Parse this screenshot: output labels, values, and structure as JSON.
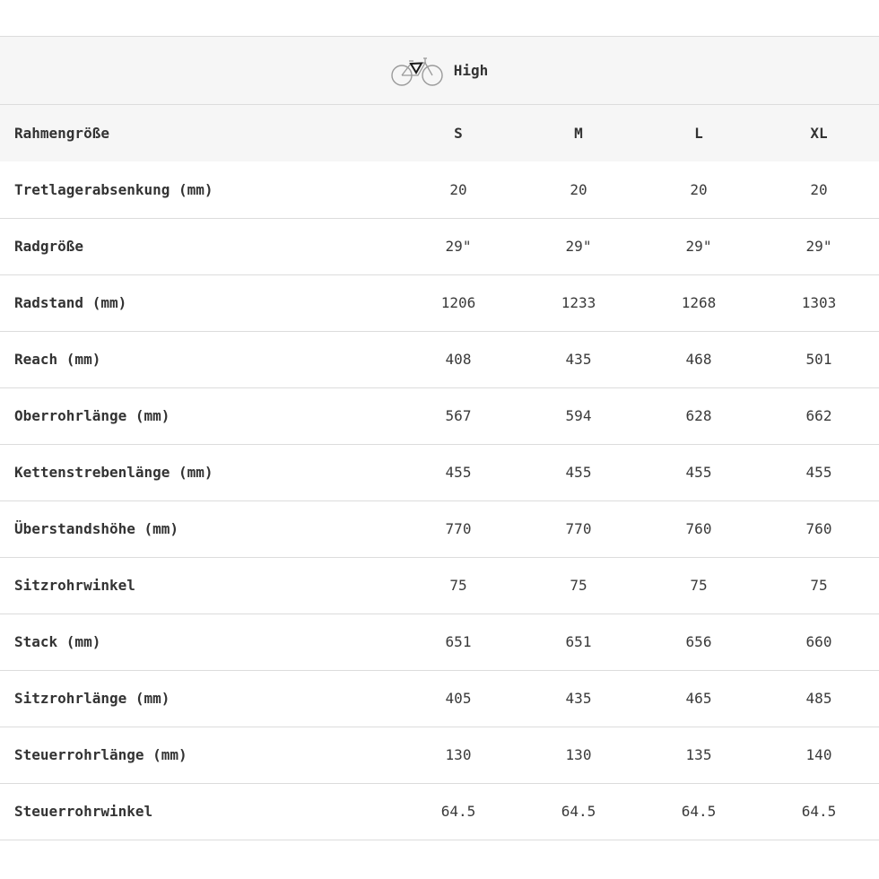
{
  "header": {
    "icon": "road-bike-icon",
    "variant_label": "High"
  },
  "table": {
    "size_header": "Rahmengröße",
    "sizes": [
      "S",
      "M",
      "L",
      "XL"
    ],
    "rows": [
      {
        "label": "Tretlagerabsenkung (mm)",
        "values": [
          "20",
          "20",
          "20",
          "20"
        ]
      },
      {
        "label": "Radgröße",
        "values": [
          "29\"",
          "29\"",
          "29\"",
          "29\""
        ]
      },
      {
        "label": "Radstand (mm)",
        "values": [
          "1206",
          "1233",
          "1268",
          "1303"
        ]
      },
      {
        "label": "Reach (mm)",
        "values": [
          "408",
          "435",
          "468",
          "501"
        ]
      },
      {
        "label": "Oberrohrlänge (mm)",
        "values": [
          "567",
          "594",
          "628",
          "662"
        ]
      },
      {
        "label": "Kettenstrebenlänge (mm)",
        "values": [
          "455",
          "455",
          "455",
          "455"
        ]
      },
      {
        "label": "Überstandshöhe (mm)",
        "values": [
          "770",
          "770",
          "760",
          "760"
        ]
      },
      {
        "label": "Sitzrohrwinkel",
        "values": [
          "75",
          "75",
          "75",
          "75"
        ]
      },
      {
        "label": "Stack (mm)",
        "values": [
          "651",
          "651",
          "656",
          "660"
        ]
      },
      {
        "label": "Sitzrohrlänge (mm)",
        "values": [
          "405",
          "435",
          "465",
          "485"
        ]
      },
      {
        "label": "Steuerrohrlänge (mm)",
        "values": [
          "130",
          "130",
          "135",
          "140"
        ]
      },
      {
        "label": "Steuerrohrwinkel",
        "values": [
          "64.5",
          "64.5",
          "64.5",
          "64.5"
        ]
      }
    ]
  }
}
